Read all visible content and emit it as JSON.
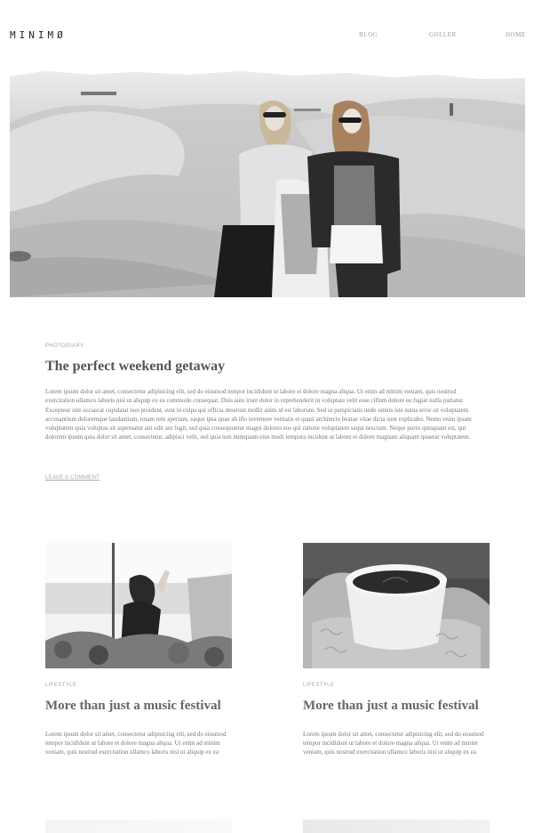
{
  "header": {
    "logo": "MINIMØ",
    "nav": {
      "blog": "BLOG",
      "goller": "GOLLER",
      "home": "HOME"
    }
  },
  "hero": {
    "image": "two-women-on-snowy-dunes-photo"
  },
  "featured": {
    "category": "PHOTODIARY",
    "title": "The perfect weekend getaway",
    "excerpt": "Lorem ipsum dolor sit amet, consectetur adipisicing elit, sed do eiusmod tempor incididunt ut labore et dolore magna aliqua. Ut enim ad minim veniam, quis nostrud exercitation ullamco laboris nisi ut aliquip ex ea commodo consequat. Duis aute irure dolor in reprehenderit in voluptate velit esse cillum dolore eu fugiat nulla pariatur. Excepteur sint occaecat cupidatat non proident, sunt in culpa qui officia deserunt mollit anim id est laborum. Sed ut perspiciatis unde omnis iste natus error sit voluptatem accusantium doloremque laudantium, totam rem aperiam, eaque ipsa quae ab illo inventore veritatis et quasi architecto beatae vitae dicta sunt explicabo. Nemo enim ipsam voluptatem quia voluptas sit aspernatur aut odit aut fugit, sed quia consequuntur magni dolores eos qui ratione voluptatem sequi nesciunt. Neque porro quisquam est, qui dolorem ipsum quia dolor sit amet, consectetur, adipisci velit, sed quia non numquam eius modi tempora incidunt ut labore et dolore magnam aliquam quaerat voluptatem.",
    "leave_comment": "LEAVE A COMMENT"
  },
  "posts": [
    {
      "category": "LIFESTYLE",
      "title": "More than just a music festival",
      "excerpt": "Lorem ipsum dolor sit amet, consectetur adipisicing elit, sed do eiusmod tempor incididunt ut labore et dolore magna aliqua. Ut enim ad minim veniam, quis nostrud exercitation ullamco laboris nisi ut aliquip ex ea",
      "image": "concert-crowd-photo"
    },
    {
      "category": "LIFESTYLE",
      "title": "More than just a music festival",
      "excerpt": "Lorem ipsum dolor sit amet, consectetur adipisicing elit, sed do eiusmod tempor incididunt ut labore et dolore magna aliqua. Ut enim ad minim veniam, quis nostrud exercitation ullamco laboris nisi ut aliquip ex ea",
      "image": "coffee-cup-in-mittens-photo"
    }
  ]
}
